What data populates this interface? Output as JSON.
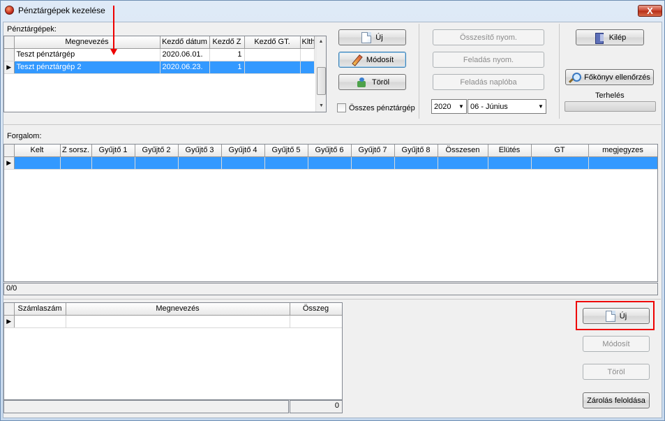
{
  "window": {
    "title": "Pénztárgépek kezelése",
    "close_label": "X"
  },
  "registers": {
    "label": "Pénztárgépek:",
    "columns": [
      "Megnevezés",
      "Kezdő dátum",
      "Kezdő Z",
      "Kezdő GT.",
      "Klth"
    ],
    "rows": [
      {
        "name": "Teszt pénztárgép",
        "date": "2020.06.01.",
        "z": "1",
        "gt": "",
        "klth": ""
      },
      {
        "name": "Teszt pénztárgép 2",
        "date": "2020.06.23.",
        "z": "1",
        "gt": "",
        "klth": ""
      }
    ],
    "selected_index": 1
  },
  "register_actions": {
    "new": "Új",
    "edit": "Módosít",
    "delete": "Töröl"
  },
  "all_registers_label": "Összes pénztárgép",
  "reports": {
    "summary_print": "Összesítő nyom.",
    "task_print": "Feladás nyom.",
    "task_log": "Feladás naplóba"
  },
  "period": {
    "year": "2020",
    "month": "06 - Június"
  },
  "right_panel": {
    "exit": "Kilép",
    "ledger_check": "Főkönyv ellenőrzés",
    "load_label": "Terhelés"
  },
  "traffic": {
    "label": "Forgalom:",
    "columns": [
      "Kelt",
      "Z sorsz.",
      "Gyűjtő 1",
      "Gyűjtő 2",
      "Gyűjtő 3",
      "Gyűjtő 4",
      "Gyűjtő 5",
      "Gyűjtő 6",
      "Gyűjtő 7",
      "Gyűjtő 8",
      "Összesen",
      "Elütés",
      "GT",
      "megjegyzes"
    ],
    "status": "0/0"
  },
  "invoices": {
    "columns": [
      "Számlaszám",
      "Megnevezés",
      "Összeg"
    ],
    "total": "0"
  },
  "invoice_actions": {
    "new": "Új",
    "edit": "Módosít",
    "delete": "Töröl",
    "unlock": "Zárolás feloldása"
  }
}
